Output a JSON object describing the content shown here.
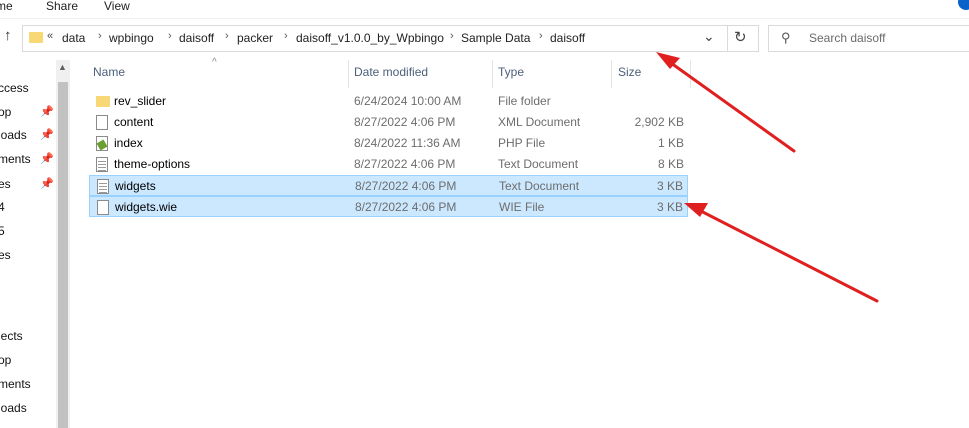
{
  "ribbon": {
    "tabs": [
      "me",
      "Share",
      "View"
    ]
  },
  "address": {
    "segments": [
      "data",
      "wpbingo",
      "daisoff",
      "packer",
      "daisoff_v1.0.0_by_Wpbingo",
      "Sample Data",
      "daisoff"
    ],
    "overflow_glyph": "«",
    "separator_glyph": "›"
  },
  "search": {
    "placeholder": "Search daisoff"
  },
  "nav": {
    "items": [
      {
        "label": "ccess",
        "pinned": false
      },
      {
        "label": "op",
        "pinned": true
      },
      {
        "label": "loads",
        "pinned": true
      },
      {
        "label": "ments",
        "pinned": true
      },
      {
        "label": "es",
        "pinned": true
      },
      {
        "label": "4",
        "pinned": false
      },
      {
        "label": "5",
        "pinned": false
      },
      {
        "label": "es",
        "pinned": false
      },
      {
        "label": "jects",
        "pinned": false
      },
      {
        "label": "op",
        "pinned": false
      },
      {
        "label": "ments",
        "pinned": false
      },
      {
        "label": "loads",
        "pinned": false
      }
    ]
  },
  "columns": {
    "name": "Name",
    "date": "Date modified",
    "type": "Type",
    "size": "Size"
  },
  "files": [
    {
      "name": "rev_slider",
      "date": "6/24/2024 10:00 AM",
      "type": "File folder",
      "size": "",
      "icon": "folder-icon",
      "selected": false
    },
    {
      "name": "content",
      "date": "8/27/2022 4:06 PM",
      "type": "XML Document",
      "size": "2,902 KB",
      "icon": "document-icon",
      "selected": false
    },
    {
      "name": "index",
      "date": "8/24/2022 11:36 AM",
      "type": "PHP File",
      "size": "1 KB",
      "icon": "php-file-icon",
      "selected": false
    },
    {
      "name": "theme-options",
      "date": "8/27/2022 4:06 PM",
      "type": "Text Document",
      "size": "8 KB",
      "icon": "text-file-icon",
      "selected": false
    },
    {
      "name": "widgets",
      "date": "8/27/2022 4:06 PM",
      "type": "Text Document",
      "size": "3 KB",
      "icon": "text-file-icon",
      "selected": true
    },
    {
      "name": "widgets.wie",
      "date": "8/27/2022 4:06 PM",
      "type": "WIE File",
      "size": "3 KB",
      "icon": "document-icon",
      "selected": true
    }
  ],
  "annotation_color": "#e02020"
}
